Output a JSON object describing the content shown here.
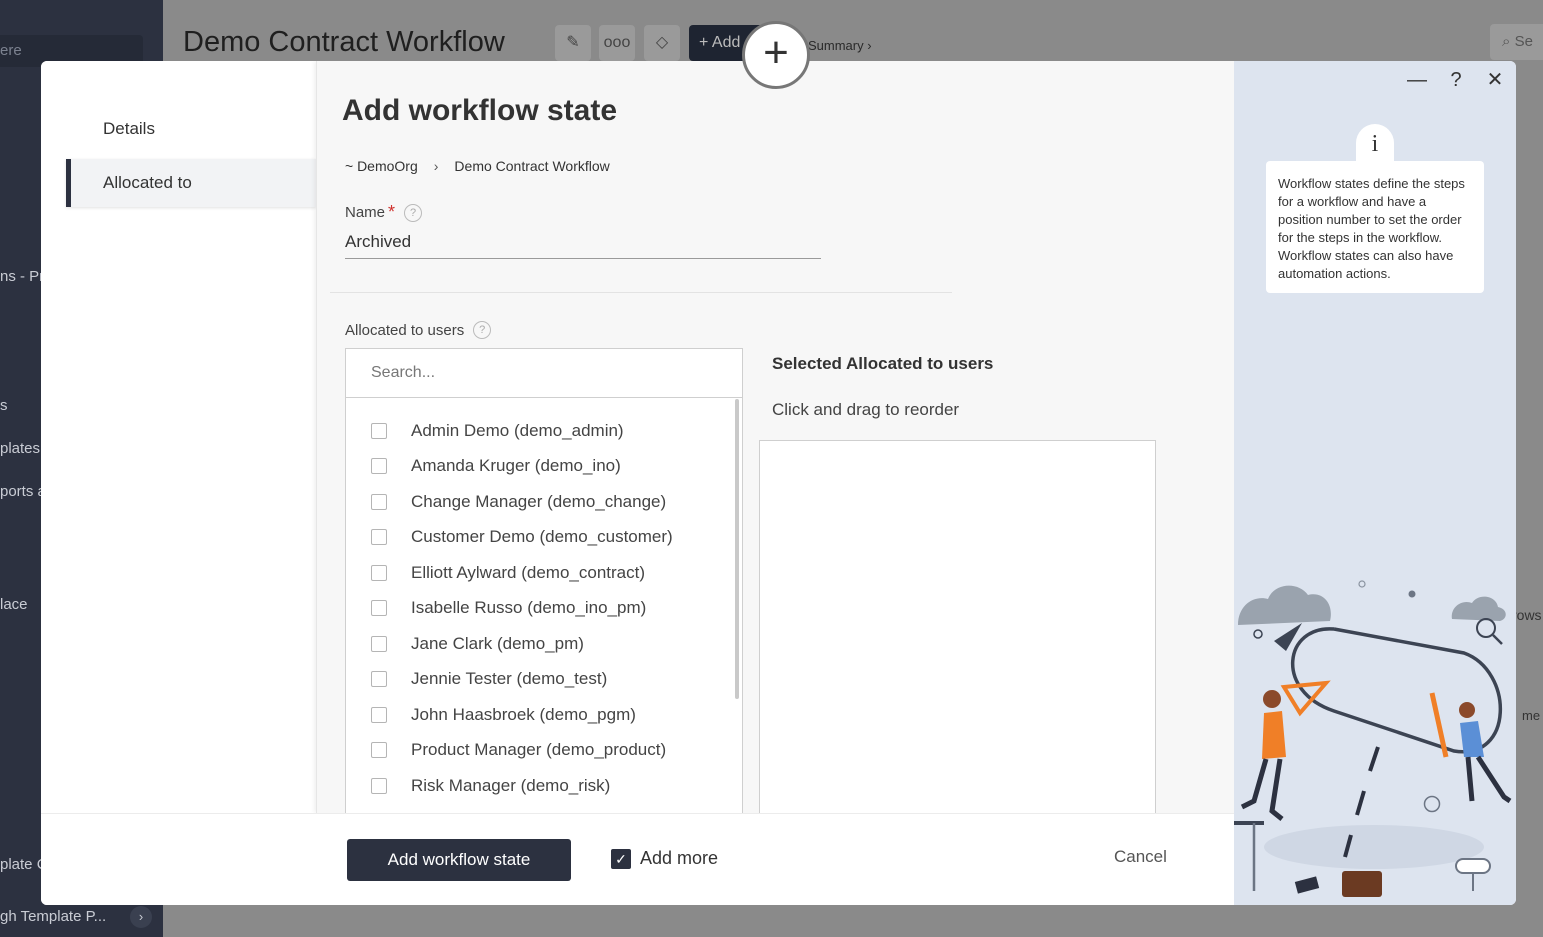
{
  "background": {
    "title": "Demo Contract Workflow",
    "add_label": "Add",
    "summary_link": "Summary ›",
    "search_placeholder": "Se",
    "sidebar_search": "ere",
    "sidebar_items": [
      "ns - Pro",
      "s",
      "plates",
      "ports a",
      "lace",
      "plate C",
      "gh Template P..."
    ],
    "right_fragments": [
      "rows",
      "me"
    ]
  },
  "modal": {
    "nav": {
      "details": "Details",
      "allocated_to": "Allocated to"
    },
    "title": "Add workflow state",
    "breadcrumb": {
      "org": "~ DemoOrg",
      "separator": "›",
      "workflow": "Demo Contract Workflow"
    },
    "name_field": {
      "label": "Name",
      "required_mark": "*",
      "help": "?",
      "value": "Archived"
    },
    "allocated": {
      "label": "Allocated to users",
      "help": "?",
      "search_placeholder": "Search...",
      "users": [
        "Admin Demo (demo_admin)",
        "Amanda Kruger (demo_ino)",
        "Change Manager (demo_change)",
        "Customer Demo (demo_customer)",
        "Elliott Aylward (demo_contract)",
        "Isabelle Russo (demo_ino_pm)",
        "Jane Clark (demo_pm)",
        "Jennie Tester (demo_test)",
        "John Haasbroek (demo_pgm)",
        "Product Manager (demo_product)",
        "Risk Manager (demo_risk)"
      ],
      "selected_title": "Selected Allocated to users",
      "selected_hint": "Click and drag to reorder"
    },
    "footer": {
      "primary": "Add workflow state",
      "add_more": "Add more",
      "add_more_checked": true,
      "cancel": "Cancel"
    },
    "info_panel": {
      "icon": "i",
      "text": "Workflow states define the steps for a workflow and have a position number to set the order for the steps in the workflow. Workflow states can also have automation actions."
    },
    "window_controls": {
      "minimize": "—",
      "help": "?",
      "close": "✕"
    }
  },
  "fab_label": "+",
  "colors": {
    "primary": "#2c3140",
    "panel_bg": "#dde4ef",
    "required": "#d0312d"
  }
}
